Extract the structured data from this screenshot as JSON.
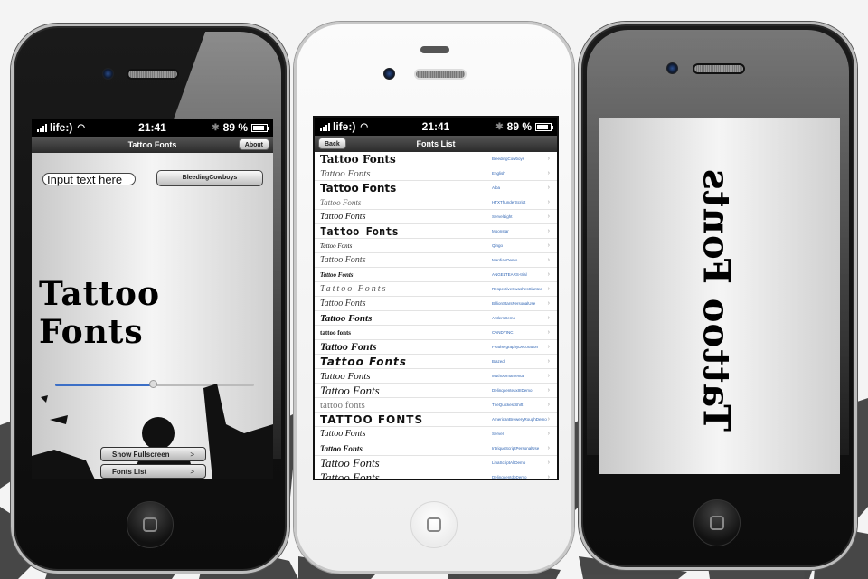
{
  "background": {
    "style": "grunge-typography",
    "ink_color": "#222222",
    "paper_color": "#f4f4f4"
  },
  "status_bar": {
    "carrier": "life:)",
    "time": "21:41",
    "battery": "89 %",
    "bluetooth": true,
    "wifi": true
  },
  "phone_main": {
    "nav_title": "Tattoo Fonts",
    "about_button": "About",
    "input_placeholder": "Input text here",
    "font_button": "BleedingCowboys",
    "preview_text": "Tattoo Fonts",
    "size_slider_fraction": 0.49,
    "show_fullscreen_button": "Show Fullscreen",
    "fonts_list_button": "Fonts List",
    "chevron": ">",
    "accent_color": "#3c6fc6"
  },
  "phone_list": {
    "nav_title": "Fonts List",
    "back_button": "Back",
    "sample_text": "Tattoo Fonts",
    "link_color": "#2f64b3",
    "items": [
      {
        "sample": "Tattoo Fonts",
        "name": "BleedingCowboys"
      },
      {
        "sample": "Tattoo Fonts",
        "name": "English"
      },
      {
        "sample": "Tattoo Fonts",
        "name": "Alba"
      },
      {
        "sample": "Tattoo Fonts",
        "name": "HTXThunderScript"
      },
      {
        "sample": "Tattoo Fonts",
        "name": "ServelLight"
      },
      {
        "sample": "Tattoo Fonts",
        "name": "Moonstar"
      },
      {
        "sample": "Tattoo Fonts",
        "name": "Qingo"
      },
      {
        "sample": "Tattoo Fonts",
        "name": "MardianDemo"
      },
      {
        "sample": "Tattoo Fonts",
        "name": "ANGELTEARS-trial"
      },
      {
        "sample": "Tattoo Fonts",
        "name": "RespectiveSwashesSlanted"
      },
      {
        "sample": "Tattoo Fonts",
        "name": "BillionStarsPersonalUse"
      },
      {
        "sample": "Tattoo Fonts",
        "name": "AntlersDemo"
      },
      {
        "sample": "tattoo fonts",
        "name": "CANDYINC"
      },
      {
        "sample": "Tattoo Fonts",
        "name": "FeathergraphyDecoration"
      },
      {
        "sample": "Tattoo Fonts",
        "name": "Blazed"
      },
      {
        "sample": "Tattoo Fonts",
        "name": "MuthoOrnamental"
      },
      {
        "sample": "Tattoo Fonts",
        "name": "DelinquenteuxIIIDemo"
      },
      {
        "sample": "tattoo fonts",
        "name": "TheQuickestShift"
      },
      {
        "sample": "TATTOO FONTS",
        "name": "AmericanBreweryRoughDemo"
      },
      {
        "sample": "Tattoo Fonts",
        "name": "Servel"
      },
      {
        "sample": "Tattoo Fonts",
        "name": "IntriqueScriptPersonalUse"
      },
      {
        "sample": "Tattoo Fonts",
        "name": "LinaScriptAltDemo"
      },
      {
        "sample": "Tattoo Fonts",
        "name": "DelinquentdoDemo"
      }
    ],
    "chevron": "›"
  },
  "phone_fullscreen": {
    "preview_text": "Tattoo Fonts",
    "orientation": "rotated-90"
  }
}
